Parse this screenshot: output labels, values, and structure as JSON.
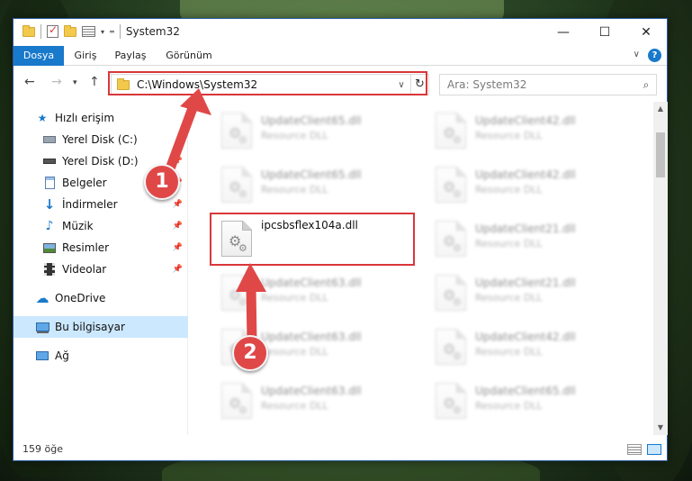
{
  "window": {
    "title": "System32",
    "controls": {
      "minimize": "—",
      "maximize": "☐",
      "close": "✕"
    }
  },
  "ribbon": {
    "tabs": [
      "Dosya",
      "Giriş",
      "Paylaş",
      "Görünüm"
    ]
  },
  "address": {
    "path": "C:\\Windows\\System32"
  },
  "search": {
    "placeholder": "Ara: System32"
  },
  "navpane": {
    "items": [
      {
        "label": "Hızlı erişim",
        "icon": "star-icon",
        "pinned": false
      },
      {
        "label": "Yerel Disk (C:)",
        "icon": "drive-icon",
        "pinned": false
      },
      {
        "label": "Yerel Disk (D:)",
        "icon": "drive-icon",
        "pinned": true
      },
      {
        "label": "Belgeler",
        "icon": "documents-icon",
        "pinned": true
      },
      {
        "label": "İndirmeler",
        "icon": "download-icon",
        "pinned": true
      },
      {
        "label": "Müzik",
        "icon": "music-icon",
        "pinned": true
      },
      {
        "label": "Resimler",
        "icon": "pictures-icon",
        "pinned": true
      },
      {
        "label": "Videolar",
        "icon": "video-icon",
        "pinned": true
      },
      {
        "label": "OneDrive",
        "icon": "cloud-icon",
        "pinned": false
      },
      {
        "label": "Bu bilgisayar",
        "icon": "computer-icon",
        "pinned": false,
        "selected": true
      },
      {
        "label": "Ağ",
        "icon": "network-icon",
        "pinned": false
      }
    ]
  },
  "files": [
    {
      "name": "UpdateClient65.dll",
      "type": "Resource DLL"
    },
    {
      "name": "UpdateClient42.dll",
      "type": "Resource DLL"
    },
    {
      "name": "UpdateClient65.dll",
      "type": "Resource DLL"
    },
    {
      "name": "UpdateClient42.dll",
      "type": "Resource DLL"
    },
    {
      "name": "ipcsbsflex104a.dll",
      "type": ""
    },
    {
      "name": "UpdateClient21.dll",
      "type": "Resource DLL"
    },
    {
      "name": "UpdateClient63.dll",
      "type": "Resource DLL"
    },
    {
      "name": "UpdateClient21.dll",
      "type": "Resource DLL"
    },
    {
      "name": "UpdateClient63.dll",
      "type": "Resource DLL"
    },
    {
      "name": "UpdateClient42.dll",
      "type": "Resource DLL"
    },
    {
      "name": "UpdateClient63.dll",
      "type": "Resource DLL"
    },
    {
      "name": "UpdateClient65.dll",
      "type": "Resource DLL"
    }
  ],
  "status": {
    "count": "159 öğe"
  },
  "annotations": {
    "step1": "1",
    "step2": "2",
    "highlight_color": "#d9373a",
    "badge_color": "#e04848"
  }
}
